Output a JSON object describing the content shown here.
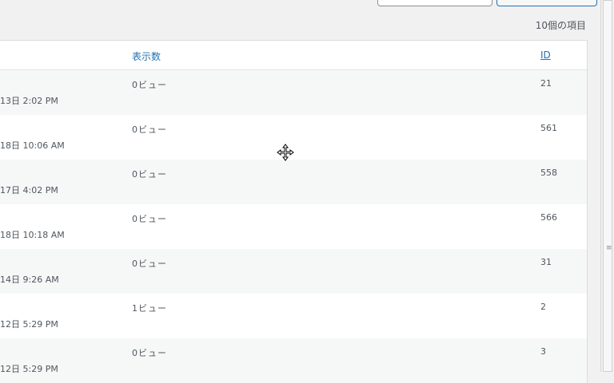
{
  "list": {
    "items_count": "10個の項目",
    "columns": {
      "views": "表示数",
      "id": "ID"
    },
    "rows": [
      {
        "date": "13日 2:02 PM",
        "views": "0ビュー",
        "id": "21"
      },
      {
        "date": "18日 10:06 AM",
        "views": "0ビュー",
        "id": "561"
      },
      {
        "date": "17日 4:02 PM",
        "views": "0ビュー",
        "id": "558"
      },
      {
        "date": "18日 10:18 AM",
        "views": "0ビュー",
        "id": "566"
      },
      {
        "date": "14日 9:26 AM",
        "views": "0ビュー",
        "id": "31"
      },
      {
        "date": "12日 5:29 PM",
        "views": "1ビュー",
        "id": "2"
      },
      {
        "date": "12日 5:29 PM",
        "views": "0ビュー",
        "id": "3"
      }
    ]
  },
  "scrollbar": {
    "grip": "≡"
  },
  "icons": {
    "cursor": "move-cursor-icon"
  }
}
